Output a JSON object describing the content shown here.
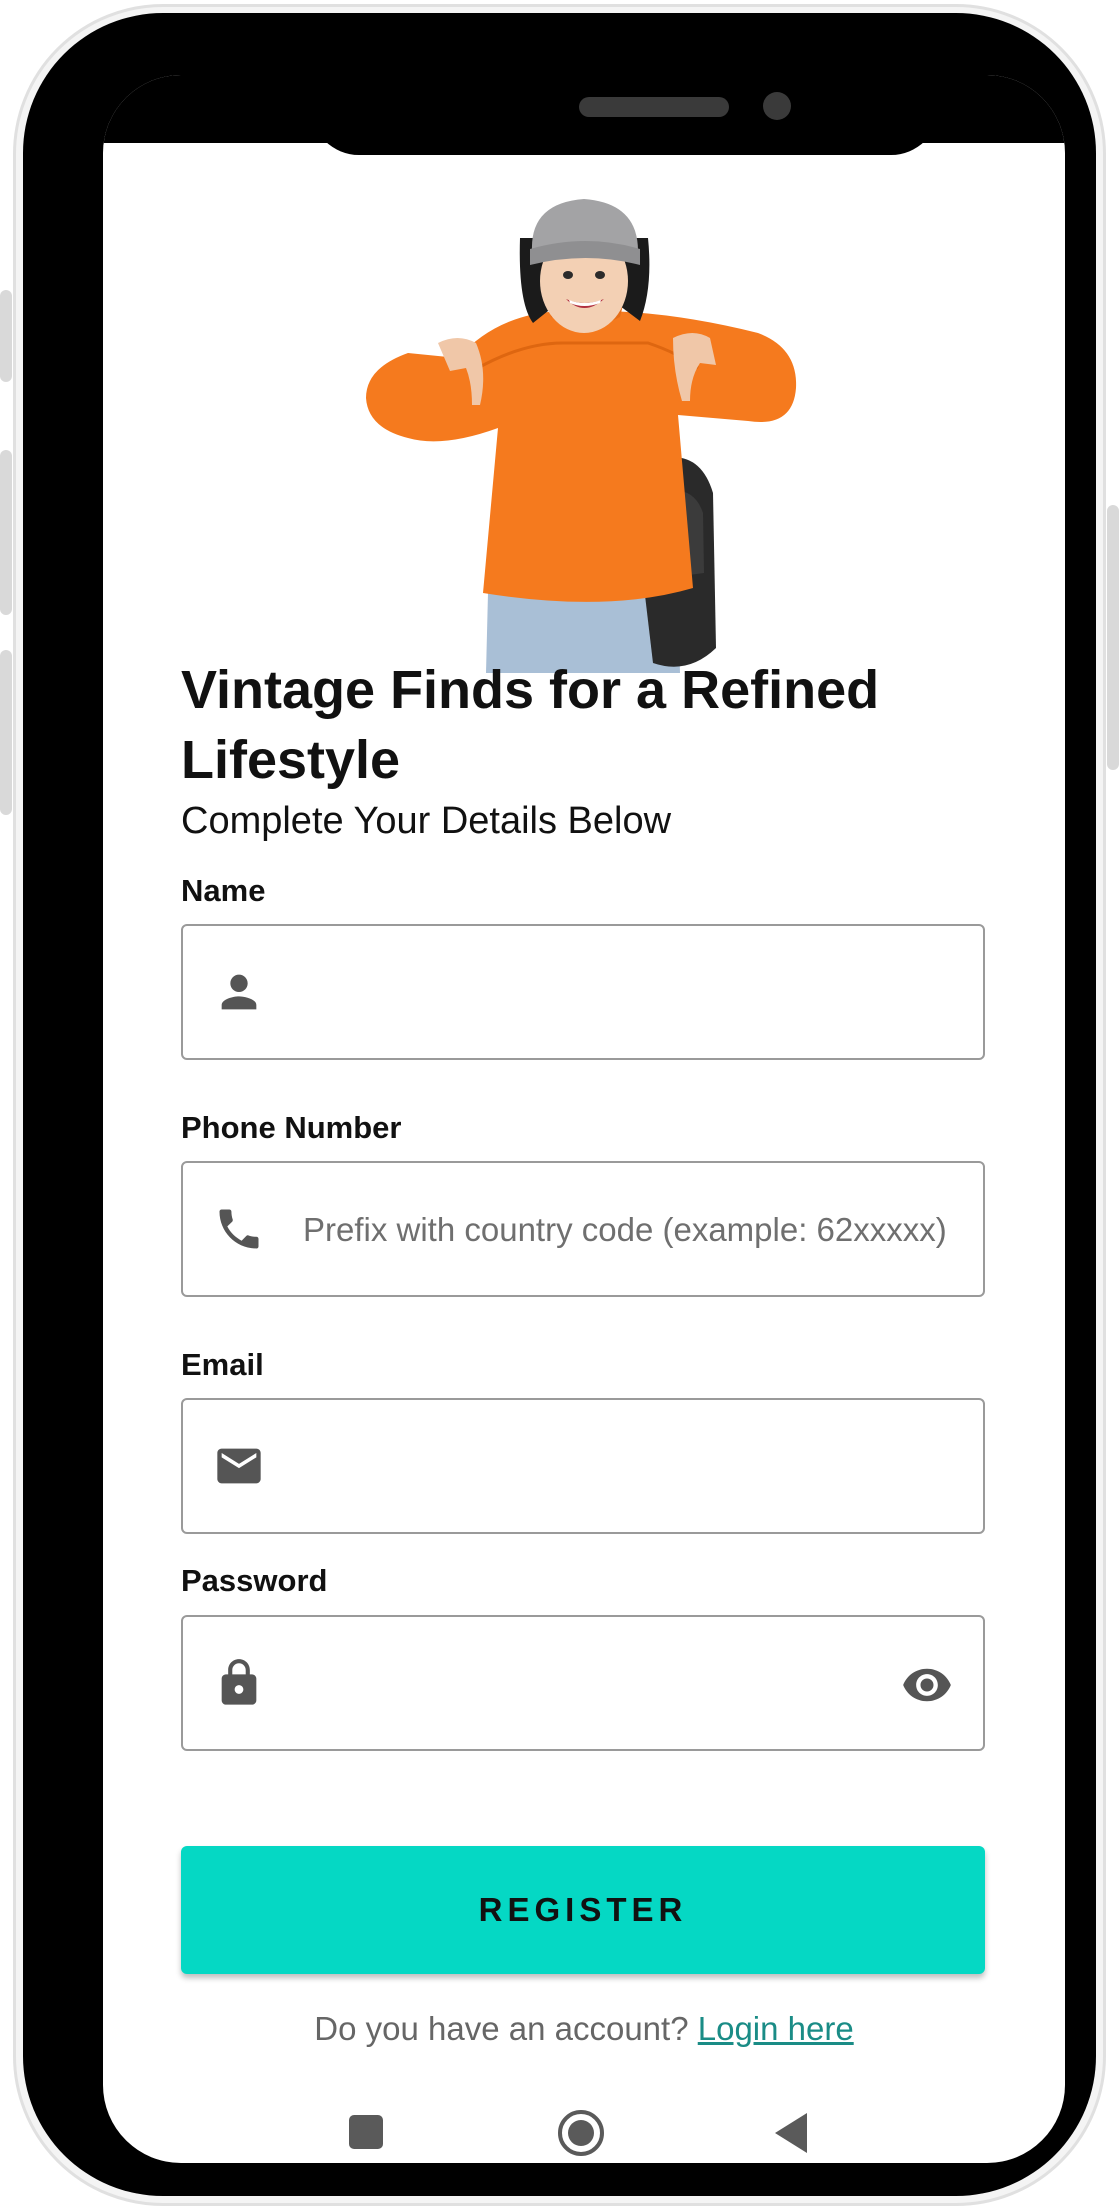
{
  "header": {
    "title": "Vintage Finds for a Refined Lifestyle",
    "subtitle": "Complete Your Details Below"
  },
  "form": {
    "name": {
      "label": "Name",
      "value": "",
      "placeholder": "",
      "icon": "person-icon"
    },
    "phone": {
      "label": "Phone Number",
      "value": "",
      "placeholder": "Prefix with country code (example: 62xxxxx)",
      "icon": "phone-icon"
    },
    "email": {
      "label": "Email",
      "value": "",
      "placeholder": "",
      "icon": "mail-icon"
    },
    "password": {
      "label": "Password",
      "value": "",
      "placeholder": "",
      "icon": "lock-icon",
      "toggle_icon": "eye-icon"
    }
  },
  "actions": {
    "register_label": "REGISTER"
  },
  "footer": {
    "prompt": "Do you have an account?",
    "login_link": "Login here"
  },
  "navigation": {
    "recents_icon": "square-icon",
    "home_icon": "circle-icon",
    "back_icon": "triangle-back-icon"
  },
  "colors": {
    "accent": "#05d8c4",
    "link": "#1a8c86",
    "sweater": "#f57a1e"
  }
}
